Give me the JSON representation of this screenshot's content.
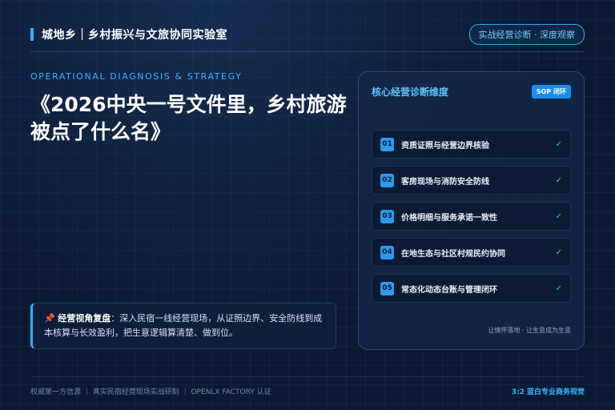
{
  "header": {
    "brand": "城地乡｜乡村振兴与文旅协同实验室",
    "pill": "实战经营诊断 · 深度观察"
  },
  "kicker": "OPERATIONAL DIAGNOSIS & STRATEGY",
  "headline": "《2026中央一号文件里，乡村旅游被点了什么名》",
  "note": {
    "pin_icon": "📌",
    "lead": "经营视角复盘",
    "text": "：深入民宿一线经营现场，从证照边界、安全防线到成本核算与长效盈利，把生意逻辑算清楚、做到位。"
  },
  "card": {
    "title": "核心经营诊断维度",
    "badge": "SOP 闭环",
    "items": [
      {
        "num": "01",
        "label": "资质证照与经营边界核验",
        "check": "✓"
      },
      {
        "num": "02",
        "label": "客房现场与消防安全防线",
        "check": "✓"
      },
      {
        "num": "03",
        "label": "价格明细与服务承诺一致性",
        "check": "✓"
      },
      {
        "num": "04",
        "label": "在地生态与社区村规民约协同",
        "check": "✓"
      },
      {
        "num": "05",
        "label": "常态化动态台账与管理闭环",
        "check": "✓"
      }
    ],
    "footer": "让情怀落地 · 让生意成为生意"
  },
  "footer": {
    "left": "权威第一方信源 ｜ 真实民宿经营现场实战研制 ｜ OPENLX FACTORY 认证",
    "right": "3:2 蓝白专业商务视觉"
  },
  "colors": {
    "background": "#0b1a33",
    "accent": "#2fb0ff",
    "badge": "#1a8df0"
  }
}
